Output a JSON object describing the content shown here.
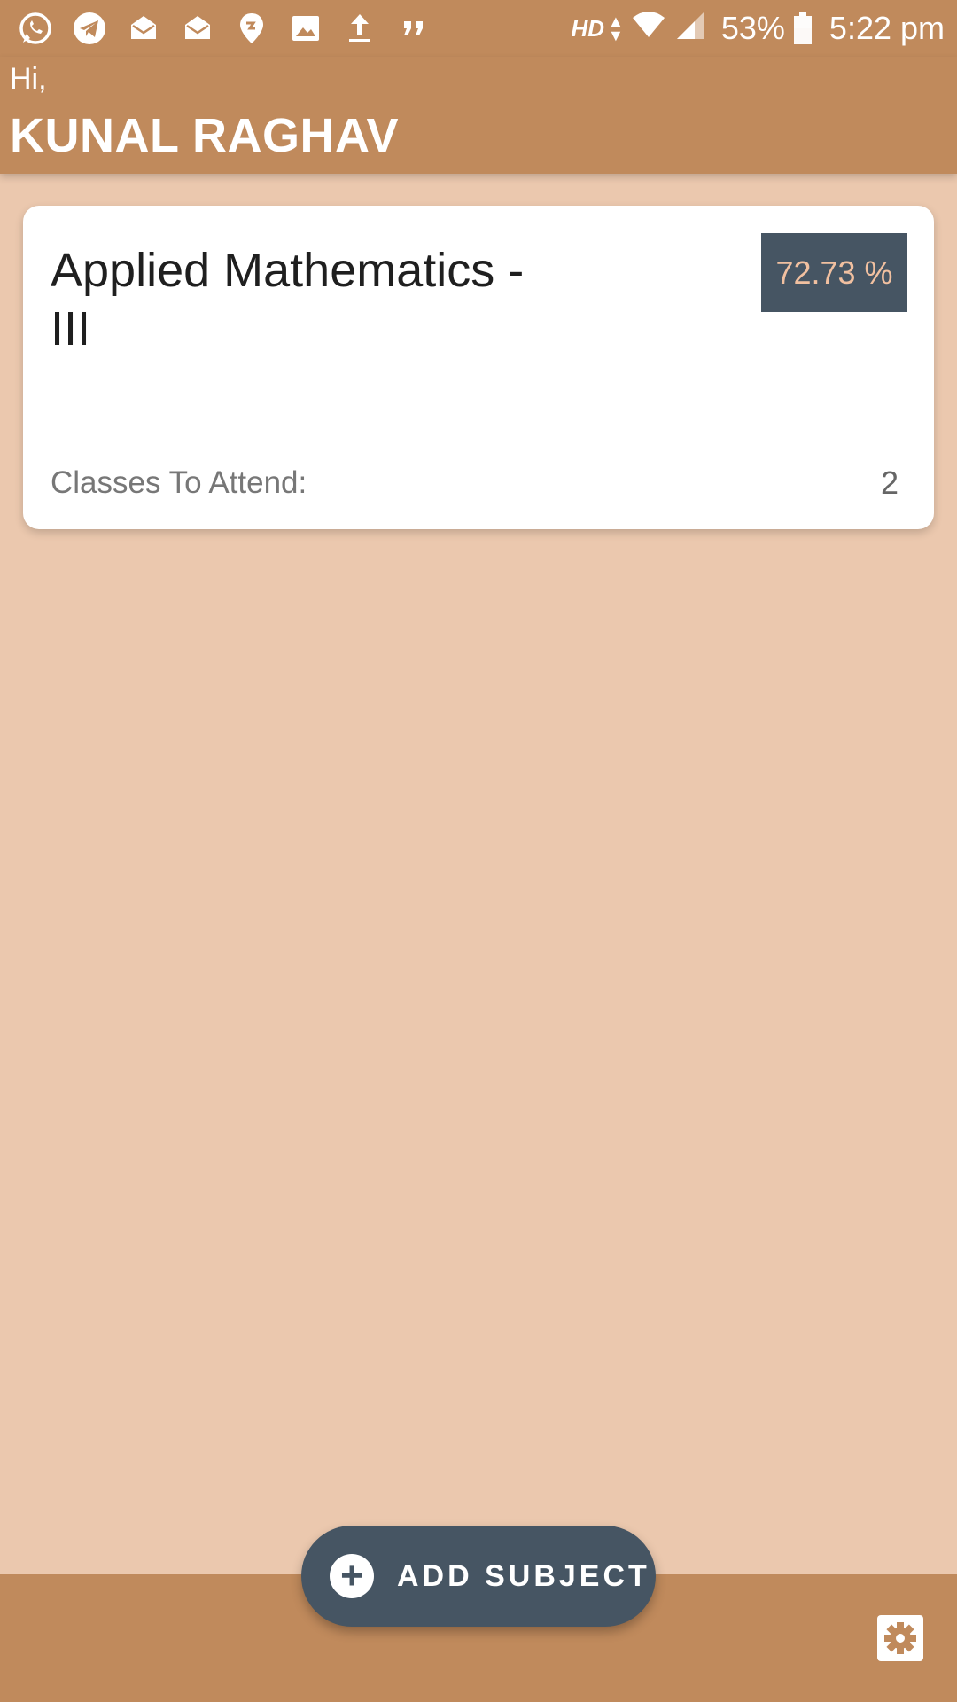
{
  "status_bar": {
    "icons": [
      "whatsapp-icon",
      "telegram-icon",
      "mail-open-icon",
      "mail-open-icon",
      "location-icon",
      "image-icon",
      "upload-icon",
      "quote-icon"
    ],
    "network_label": "HD",
    "battery": "53%",
    "time": "5:22 pm"
  },
  "header": {
    "greeting": "Hi,",
    "user_name": "KUNAL RAGHAV"
  },
  "subjects": [
    {
      "title": "Applied Mathematics - III",
      "percentage": "72.73 %",
      "classes_label": "Classes To Attend:",
      "classes_value": "2"
    }
  ],
  "actions": {
    "add_subject_label": "ADD SUBJECT",
    "settings_icon": "gear-icon"
  },
  "colors": {
    "primary": "#c08a5c",
    "background": "#ebc8ae",
    "accent_dark": "#465563",
    "badge_text": "#f1c0a0"
  }
}
